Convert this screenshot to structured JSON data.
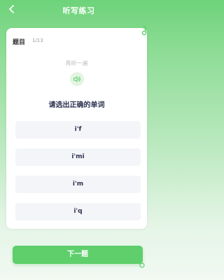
{
  "header": {
    "title": "听写练习"
  },
  "question": {
    "label": "题目",
    "count": "1/13",
    "replay": "再听一遍",
    "prompt": "请选出正确的单词"
  },
  "options": [
    {
      "text": "i'f"
    },
    {
      "text": "i'mi"
    },
    {
      "text": "i'm"
    },
    {
      "text": "i'q"
    }
  ],
  "next_button": {
    "label": "下一题"
  },
  "colors": {
    "brand_green": "#5ecf6b",
    "speaker_bg": "#e4f4e3"
  }
}
